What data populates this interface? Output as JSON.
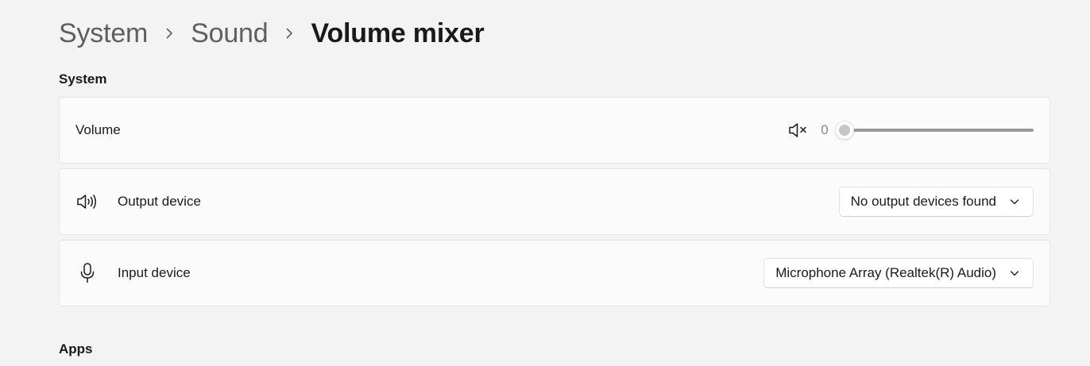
{
  "breadcrumb": {
    "items": [
      "System",
      "Sound"
    ],
    "current": "Volume mixer"
  },
  "sections": {
    "system_title": "System",
    "apps_title": "Apps"
  },
  "volume": {
    "label": "Volume",
    "value": "0",
    "level": 0,
    "muted": true,
    "icon": "speaker-muted-icon"
  },
  "output": {
    "label": "Output device",
    "selected": "No output devices found",
    "icon": "speaker-icon"
  },
  "input": {
    "label": "Input device",
    "selected": "Microphone Array (Realtek(R) Audio)",
    "icon": "microphone-icon"
  },
  "colors": {
    "background": "#f3f3f3",
    "card": "#fbfbfb",
    "text": "#1a1a1a",
    "muted_text": "#5f5f5f"
  }
}
